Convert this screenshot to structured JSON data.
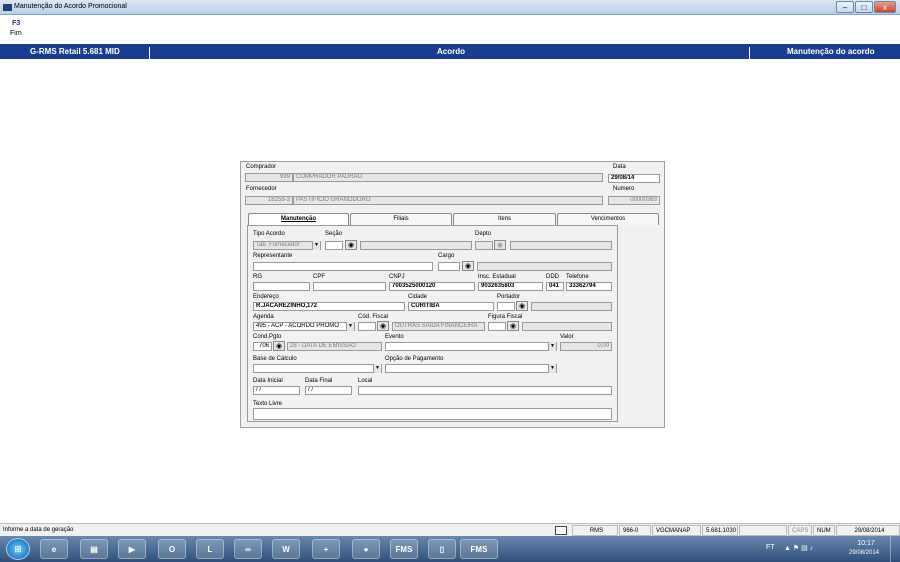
{
  "window": {
    "title": "Manutenção do Acordo Promocional",
    "minimize": "–",
    "maximize": "□",
    "close": "x"
  },
  "menu": {
    "key": "F3",
    "label": "Fim"
  },
  "header": {
    "left": "G-RMS Retail 5.681 MID",
    "center": "Acordo",
    "right": "Manutenção do acordo"
  },
  "form": {
    "comprador_label": "Comprador",
    "comprador_code": "999",
    "comprador_name": "COMPRADOR PADRAO",
    "data_label": "Data",
    "data_value": "29/08/14",
    "fornecedor_label": "Fornecedor",
    "fornecedor_code": "18258-3",
    "fornecedor_name": "PASTIFICIO GRANODORO",
    "numero_label": "Numero",
    "numero_value": "00000363"
  },
  "tabs": [
    {
      "label": "Manutenção",
      "active": true
    },
    {
      "label": "Filiais",
      "active": false
    },
    {
      "label": "Itens",
      "active": false
    },
    {
      "label": "Vencimentos",
      "active": false
    }
  ],
  "manut": {
    "tipo_acordo_label": "Tipo Acordo",
    "tipo_acordo_value": "Tab. Fornecedor",
    "secao_label": "Seção",
    "depto_label": "Depto",
    "representante_label": "Representante",
    "cargo_label": "Cargo",
    "rg_label": "RG",
    "cpf_label": "CPF",
    "cnpj_label": "CNPJ",
    "cnpj_value": "7003525000120",
    "insc_label": "Insc. Estadual",
    "insc_value": "9032635803",
    "ddd_label": "DDD",
    "ddd_value": "041",
    "telefone_label": "Telefone",
    "telefone_value": "33362794",
    "endereco_label": "Endereço",
    "endereco_value": "R.JACAREZINHO,172",
    "cidade_label": "Cidade",
    "cidade_value": "CURITIBA",
    "portador_label": "Portador",
    "agenda_label": "Agenda",
    "agenda_value": "495 - ACP - ACORDO PROMO",
    "cod_fiscal_label": "Cód. Fiscal",
    "cod_fiscal_value": "OUTRAS SAIDA FINANCEIRA",
    "figura_fiscal_label": "Figura Fiscal",
    "cond_pgto_label": "Cond.Pgto",
    "cond_pgto_code": "706",
    "cond_pgto_value": "28 - DATA DE EMISSAO",
    "evento_label": "Evento",
    "valor_label": "Valor",
    "valor_value": "0,00",
    "base_calculo_label": "Base de Cálculo",
    "opcao_pagamento_label": "Opção de Pagamento",
    "data_inicial_label": "Data Inicial",
    "data_inicial_value": " / /",
    "data_final_label": "Data Final",
    "data_final_value": " / /",
    "local_label": "Local",
    "texto_livre_label": "Texto Livre"
  },
  "status": {
    "message": "Informe a data de geração",
    "app": "RMS",
    "code": "966-0",
    "user": "VGCMANAP",
    "version": "5.681.1030",
    "caps": "CAPS",
    "num": "NUM",
    "date": "29/08/2014"
  },
  "taskbar": {
    "apps": [
      "ie-icon",
      "explorer-icon",
      "media-icon",
      "outlook-icon",
      "lync-icon",
      "infinity-icon",
      "word-icon",
      "addon-icon",
      "rms-icon",
      "FMS",
      "tablet-icon",
      "FMS"
    ],
    "lang": "FT",
    "time": "10:17",
    "date": "29/08/2014"
  }
}
